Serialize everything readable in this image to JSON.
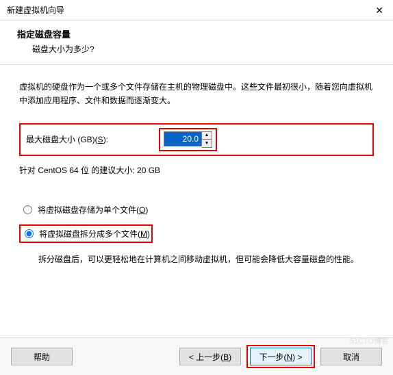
{
  "window": {
    "title": "新建虚拟机向导",
    "close_glyph": "✕"
  },
  "header": {
    "heading": "指定磁盘容量",
    "sub": "磁盘大小为多少?"
  },
  "content": {
    "description": "虚拟机的硬盘作为一个或多个文件存储在主机的物理磁盘中。这些文件最初很小，随着您向虚拟机中添加应用程序、文件和数据而逐渐变大。",
    "maxsize_label_pre": "最大磁盘大小 (GB)(",
    "maxsize_key": "S",
    "maxsize_label_post": "):",
    "maxsize_value": "20.0",
    "recommend": "针对 CentOS 64 位 的建议大小: 20 GB",
    "radio": {
      "single_pre": "将虚拟磁盘存储为单个文件(",
      "single_key": "O",
      "single_post": ")",
      "split_pre": "将虚拟磁盘拆分成多个文件(",
      "split_key": "M",
      "split_post": ")",
      "split_desc": "拆分磁盘后，可以更轻松地在计算机之间移动虚拟机，但可能会降低大容量磁盘的性能。"
    }
  },
  "footer": {
    "help": "帮助",
    "back_pre": "< 上一步(",
    "back_key": "B",
    "back_post": ")",
    "next_pre": "下一步(",
    "next_key": "N",
    "next_post": ") >",
    "cancel": "取消"
  },
  "watermark": "51CTO博客"
}
